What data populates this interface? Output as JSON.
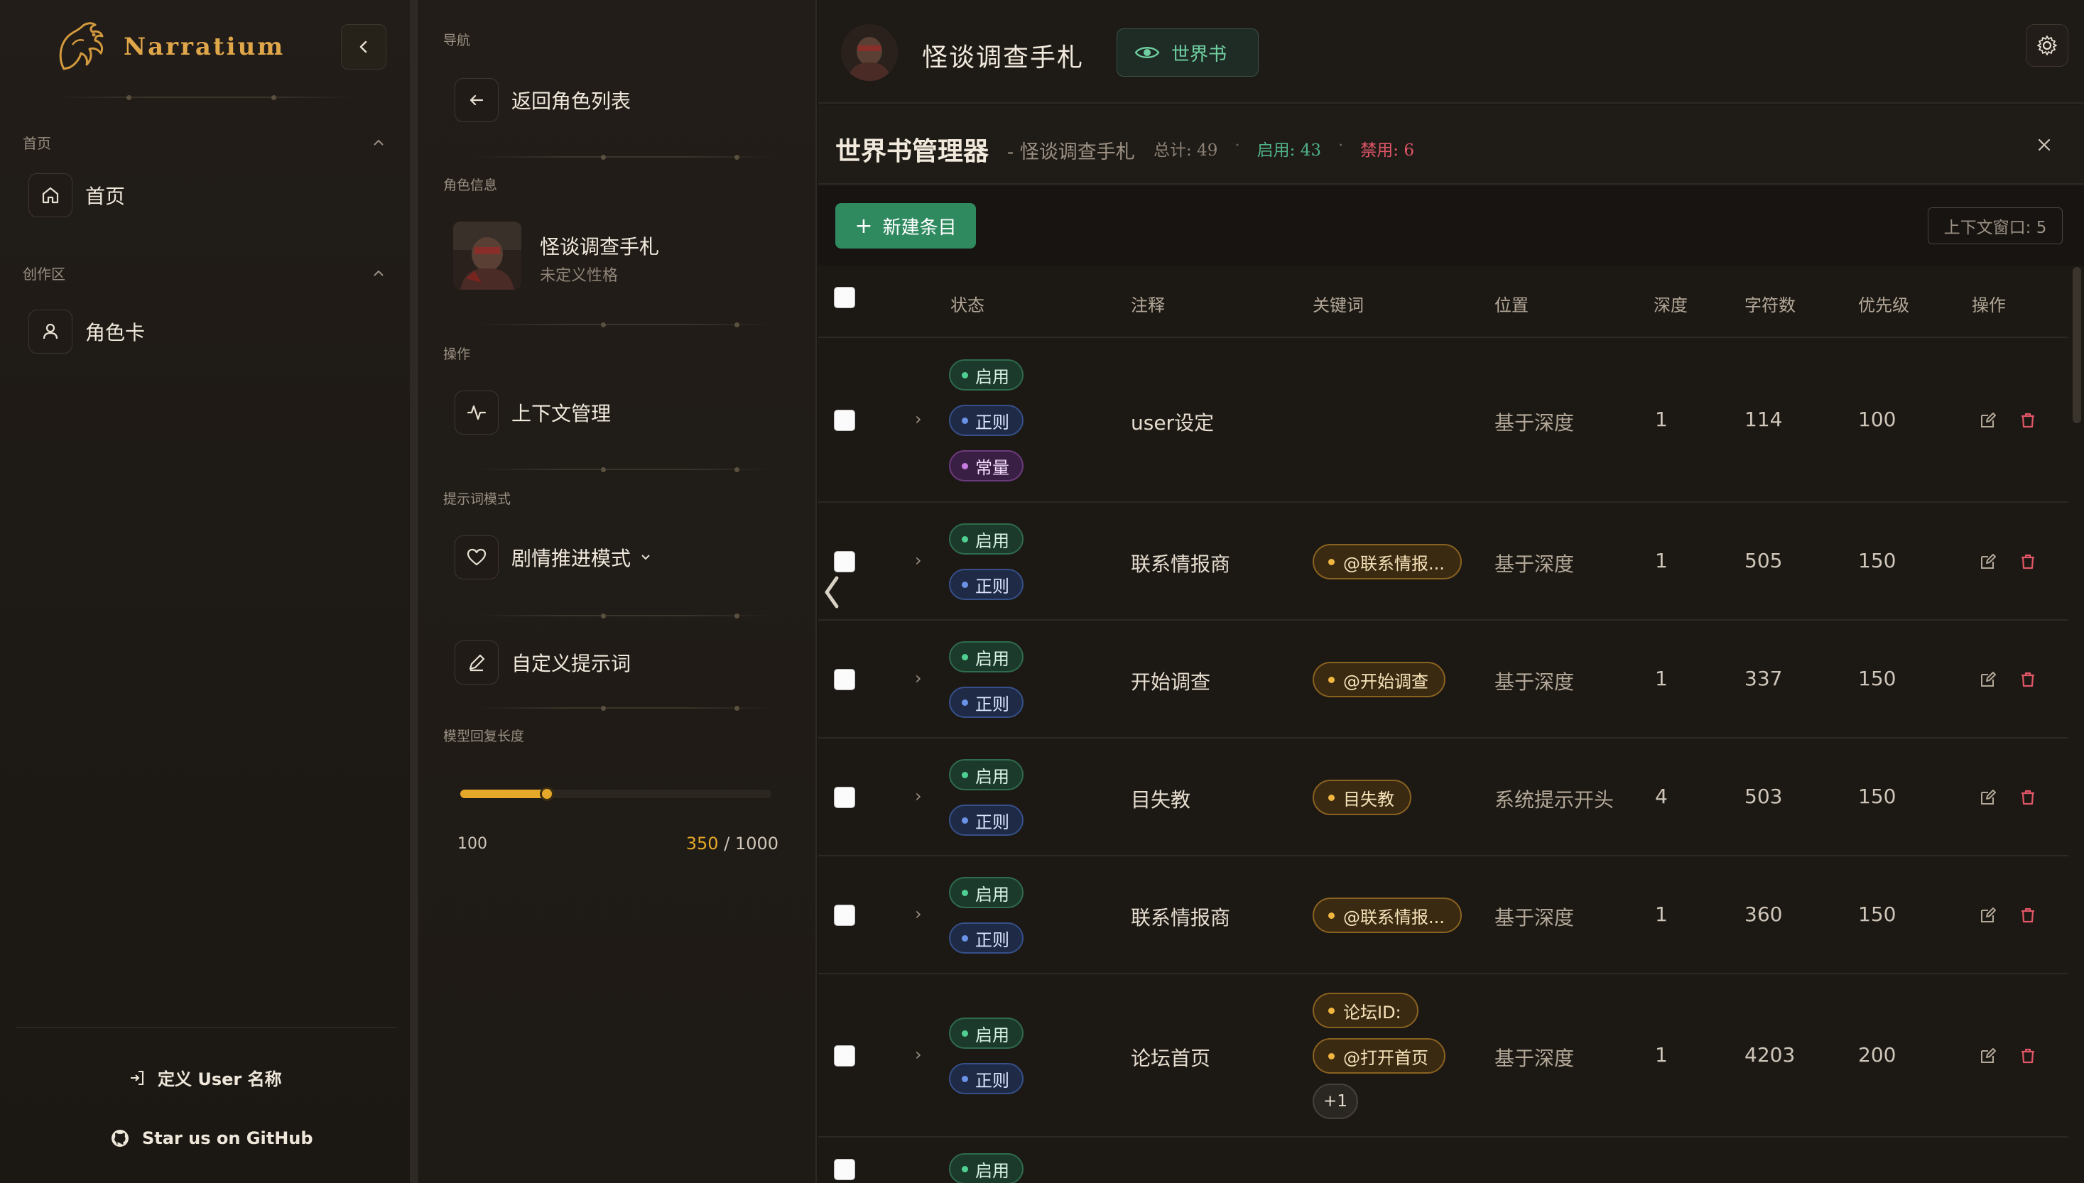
{
  "sidebar": {
    "brand": "Narratium",
    "sections": [
      {
        "title": "首页",
        "items": [
          {
            "label": "首页",
            "icon": "home-icon"
          }
        ]
      },
      {
        "title": "创作区",
        "items": [
          {
            "label": "角色卡",
            "icon": "user-icon"
          }
        ]
      }
    ],
    "footer": {
      "define_user": "定义 User 名称",
      "github": "Star us on GitHub"
    }
  },
  "panel": {
    "nav_label": "导航",
    "back_label": "返回角色列表",
    "char_info_label": "角色信息",
    "char_name": "怪谈调查手札",
    "char_personality": "未定义性格",
    "ops_label": "操作",
    "context_manage": "上下文管理",
    "prompt_mode_label": "提示词模式",
    "prompt_mode_value": "剧情推进模式",
    "custom_prompt": "自定义提示词",
    "reply_length_label": "模型回复长度",
    "slider": {
      "min": "100",
      "current": "350",
      "max": "1000",
      "fraction": 0.2778
    }
  },
  "header": {
    "title": "怪谈调查手札",
    "worldbook_label": "世界书"
  },
  "manager": {
    "title": "世界书管理器",
    "subtitle": "- 怪谈调查手札",
    "total": "总计: 49",
    "enabled": "启用: 43",
    "disabled": "禁用: 6",
    "new_entry": "新建条目",
    "context_window": "上下文窗口: 5"
  },
  "table": {
    "headers": {
      "status": "状态",
      "comment": "注释",
      "keywords": "关键词",
      "position": "位置",
      "depth": "深度",
      "chars": "字符数",
      "priority": "优先级",
      "actions": "操作"
    },
    "rows": [
      {
        "badges": [
          "启用",
          "正则",
          "常量"
        ],
        "comment": "user设定",
        "keywords": [],
        "position": "基于深度",
        "depth": "1",
        "chars": "114",
        "priority": "100"
      },
      {
        "badges": [
          "启用",
          "正则"
        ],
        "comment": "联系情报商",
        "keywords": [
          "@联系情报..."
        ],
        "position": "基于深度",
        "depth": "1",
        "chars": "505",
        "priority": "150"
      },
      {
        "badges": [
          "启用",
          "正则"
        ],
        "comment": "开始调查",
        "keywords": [
          "@开始调查"
        ],
        "position": "基于深度",
        "depth": "1",
        "chars": "337",
        "priority": "150"
      },
      {
        "badges": [
          "启用",
          "正则"
        ],
        "comment": "目失教",
        "keywords": [
          "目失教"
        ],
        "position": "系统提示开头",
        "depth": "4",
        "chars": "503",
        "priority": "150"
      },
      {
        "badges": [
          "启用",
          "正则"
        ],
        "comment": "联系情报商",
        "keywords": [
          "@联系情报..."
        ],
        "position": "基于深度",
        "depth": "1",
        "chars": "360",
        "priority": "150"
      },
      {
        "badges": [
          "启用",
          "正则"
        ],
        "comment": "论坛首页",
        "keywords": [
          "论坛ID:",
          "@打开首页"
        ],
        "more": "+1",
        "position": "基于深度",
        "depth": "1",
        "chars": "4203",
        "priority": "200"
      },
      {
        "badges": [
          "启用"
        ],
        "comment": "",
        "keywords": [],
        "position": "",
        "depth": "",
        "chars": "",
        "priority": ""
      }
    ]
  },
  "colors": {
    "accent_gold": "#e0a64a",
    "enabled_green": "#2f8a5f",
    "disabled_red": "#e05667"
  }
}
